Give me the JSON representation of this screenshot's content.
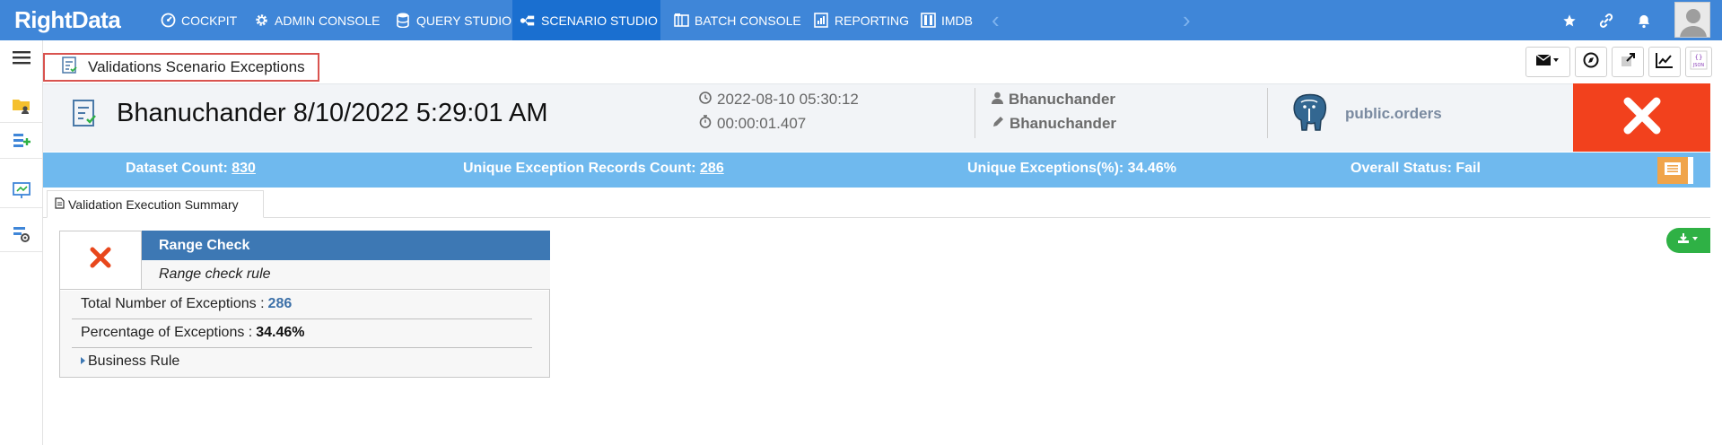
{
  "brand": {
    "logo_text": "RightData"
  },
  "nav": {
    "items": [
      {
        "label": "COCKPIT",
        "icon": "dashboard-icon"
      },
      {
        "label": "ADMIN CONSOLE",
        "icon": "gear-icon"
      },
      {
        "label": "QUERY STUDIO",
        "icon": "database-icon"
      },
      {
        "label": "SCENARIO STUDIO",
        "icon": "scenario-icon",
        "active": true
      },
      {
        "label": "BATCH CONSOLE",
        "icon": "batch-icon"
      },
      {
        "label": "REPORTING",
        "icon": "report-icon"
      },
      {
        "label": "IMDB",
        "icon": "imdb-icon"
      }
    ],
    "right_icons": [
      "star-icon",
      "link-icon",
      "bell-icon",
      "avatar"
    ]
  },
  "sidebar": {
    "items": [
      "menu-icon",
      "folder-user-icon",
      "add-list-icon",
      "presentation-icon",
      "settings-search-icon"
    ]
  },
  "page": {
    "title": "Validations Scenario Exceptions",
    "toolbar": [
      "email-icon",
      "compass-icon",
      "external-link-icon",
      "line-chart-icon",
      "json-icon"
    ]
  },
  "header": {
    "run_title": "Bhanuchander 8/10/2022 5:29:01 AM",
    "timestamp": "2022-08-10 05:30:12",
    "duration": "00:00:01.407",
    "created_by": "Bhanuchander",
    "modified_by": "Bhanuchander",
    "datasource": "public.orders",
    "status_color": "#f2411d"
  },
  "stats": {
    "dataset_label": "Dataset Count: ",
    "dataset_value": "830",
    "unique_records_label": "Unique Exception Records Count: ",
    "unique_records_value": "286",
    "unique_pct": "Unique Exceptions(%): 34.46%",
    "overall_status": "Overall Status: Fail"
  },
  "tabs": [
    {
      "label": "Validation Execution Summary"
    }
  ],
  "card": {
    "title": "Range Check",
    "subtitle": "Range check rule",
    "exceptions_label": "Total Number of Exceptions : ",
    "exceptions_value": "286",
    "percentage_label": "Percentage of Exceptions : ",
    "percentage_value": "34.46%",
    "business_rule_label": "Business Rule"
  }
}
